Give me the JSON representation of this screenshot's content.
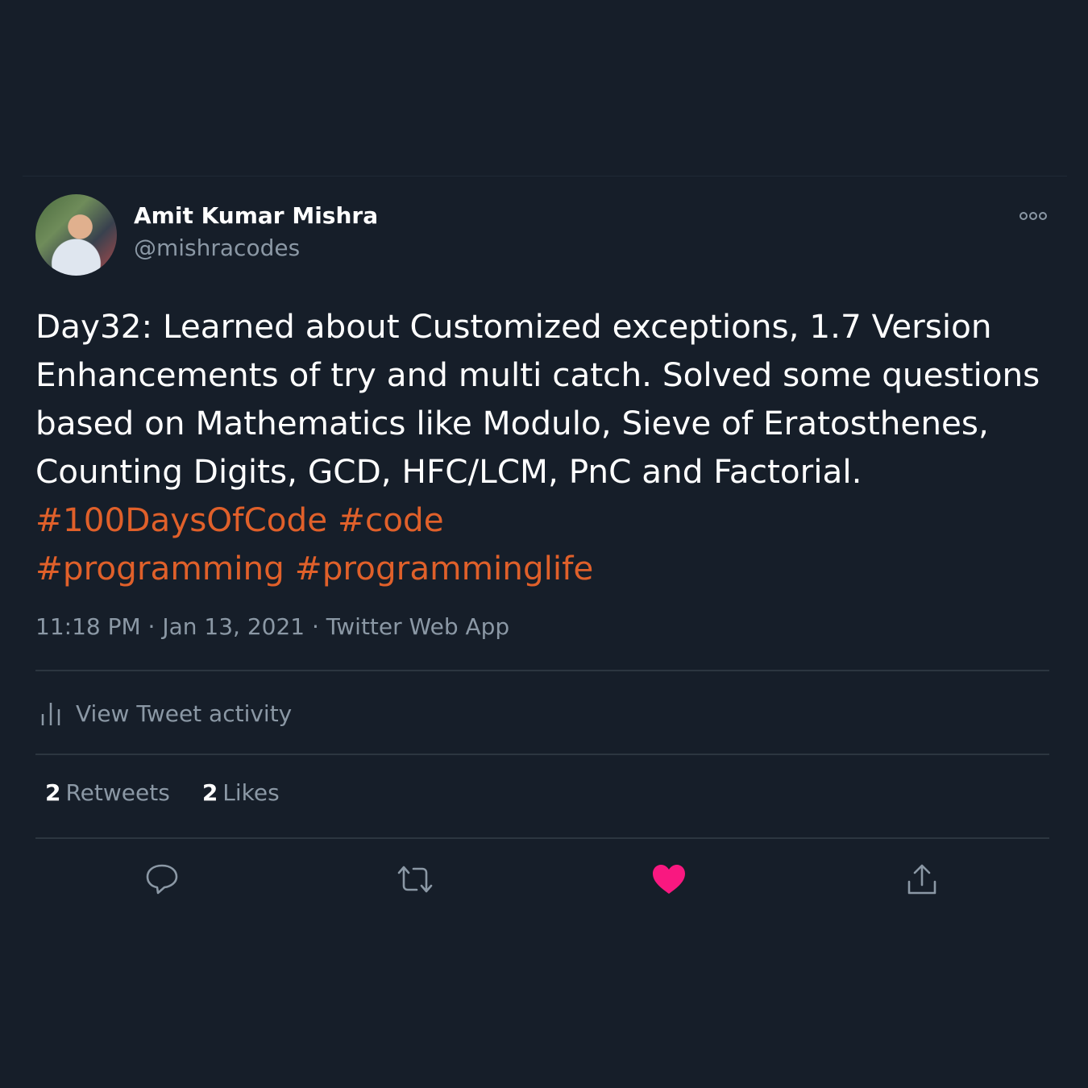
{
  "author": {
    "name": "Amit Kumar Mishra",
    "handle": "@mishracodes"
  },
  "tweet": {
    "text_lines": [
      "Day32: Learned about Customized exceptions, 1.7 Version",
      "Enhancements of try and multi catch. Solved some questions",
      "based on Mathematics like Modulo, Sieve of Eratosthenes,",
      "Counting Digits, GCD, HFC/LCM, PnC and Factorial."
    ],
    "hashtags": [
      "#100DaysOfCode",
      "#code",
      "#programming",
      "#programminglife"
    ],
    "time": "11:18 PM",
    "date": "Jan 13, 2021",
    "source": "Twitter Web App",
    "separator": " · "
  },
  "activity": {
    "label": "View Tweet activity",
    "icon": "bar-chart-icon"
  },
  "stats": {
    "retweets": {
      "count": "2",
      "label": "Retweets"
    },
    "likes": {
      "count": "2",
      "label": "Likes"
    }
  },
  "actions": {
    "reply_icon": "speech-bubble-icon",
    "retweet_icon": "retweet-arrows-icon",
    "like_icon": "heart-icon",
    "share_icon": "share-upload-icon",
    "liked": true
  },
  "colors": {
    "background": "#161e29",
    "text": "#ffffff",
    "secondary_text": "#8b98a5",
    "hashtag": "#e0602a",
    "like": "#f91880",
    "divider": "#2c3640"
  }
}
